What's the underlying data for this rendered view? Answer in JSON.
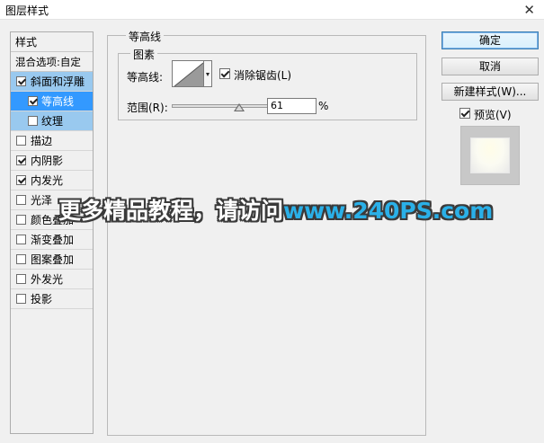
{
  "window": {
    "title": "图层样式",
    "close_glyph": "✕"
  },
  "style_list": {
    "header": "样式",
    "blend_options": "混合选项:自定",
    "items": [
      {
        "label": "斜面和浮雕",
        "checked": true
      },
      {
        "label": "等高线",
        "checked": true
      },
      {
        "label": "纹理",
        "checked": false
      },
      {
        "label": "描边",
        "checked": false
      },
      {
        "label": "内阴影",
        "checked": true
      },
      {
        "label": "内发光",
        "checked": true
      },
      {
        "label": "光泽",
        "checked": false
      },
      {
        "label": "颜色叠加",
        "checked": false
      },
      {
        "label": "渐变叠加",
        "checked": false
      },
      {
        "label": "图案叠加",
        "checked": false
      },
      {
        "label": "外发光",
        "checked": false
      },
      {
        "label": "投影",
        "checked": false
      }
    ]
  },
  "panel": {
    "group_title": "等高线",
    "elements_title": "图素",
    "contour_label": "等高线:",
    "antialias_label": "消除锯齿(L)",
    "antialias_checked": true,
    "range_label": "范围(R):",
    "range_value": "61",
    "range_fraction": 0.61,
    "range_unit": "%"
  },
  "buttons": {
    "ok": "确定",
    "cancel": "取消",
    "new_style": "新建样式(W)...",
    "preview_label": "预览(V)",
    "preview_checked": true
  },
  "watermark": {
    "text": "更多精品教程，请访问",
    "site": "www.240PS.com"
  }
}
